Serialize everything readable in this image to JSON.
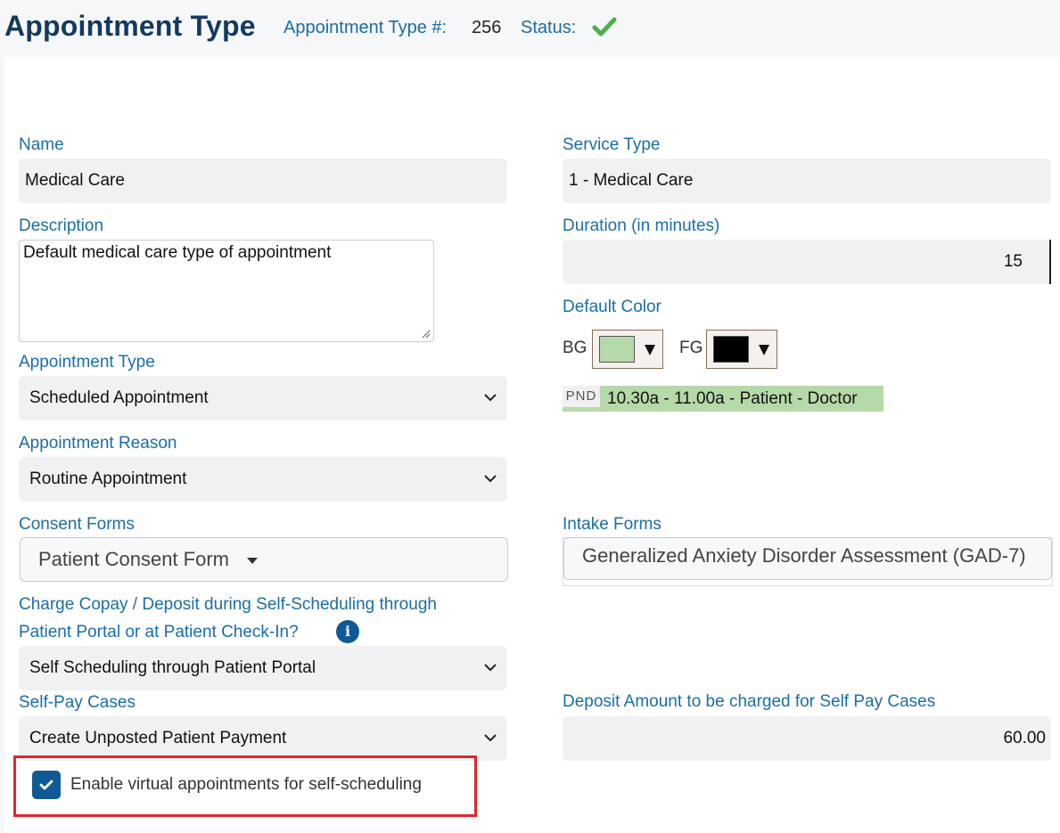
{
  "header": {
    "title": "Appointment Type",
    "type_number_label": "Appointment Type #:",
    "type_number_value": "256",
    "status_label": "Status:",
    "status_icon": "check-icon",
    "status_color": "#4cae4f"
  },
  "form": {
    "name": {
      "label": "Name",
      "value": "Medical Care"
    },
    "service_type": {
      "label": "Service Type",
      "value": "1 - Medical Care"
    },
    "description": {
      "label": "Description",
      "value": "Default medical care type of appointment"
    },
    "duration": {
      "label": "Duration (in minutes)",
      "value": "15"
    },
    "default_color": {
      "label": "Default Color",
      "bg_label": "BG",
      "bg_color": "#b6d9a9",
      "fg_label": "FG",
      "fg_color": "#000000",
      "preview_badge": "PND",
      "preview_text": "10.30a - 11.00a - Patient - Doctor"
    },
    "appointment_type": {
      "label": "Appointment Type",
      "value": "Scheduled Appointment"
    },
    "appointment_reason": {
      "label": "Appointment Reason",
      "value": "Routine Appointment"
    },
    "consent_forms": {
      "label": "Consent Forms",
      "value": "Patient Consent Form"
    },
    "intake_forms": {
      "label": "Intake Forms",
      "value": "Generalized Anxiety Disorder Assessment (GAD-7)"
    },
    "charge_copay": {
      "label_line1": "Charge Copay / Deposit during Self-Scheduling through",
      "label_line2": "Patient Portal or at Patient Check-In?",
      "value": "Self Scheduling through Patient Portal"
    },
    "self_pay_cases": {
      "label": "Self-Pay Cases",
      "value": "Create Unposted Patient Payment"
    },
    "deposit_amount": {
      "label": "Deposit Amount to be charged for Self Pay Cases",
      "value": "60.00"
    },
    "virtual_appointments": {
      "label": "Enable virtual appointments for self-scheduling",
      "checked": true
    }
  },
  "colors": {
    "accent": "#1b6da6",
    "title": "#14395f",
    "checkbox": "#0f5a94",
    "highlight_box": "#e0252f"
  }
}
